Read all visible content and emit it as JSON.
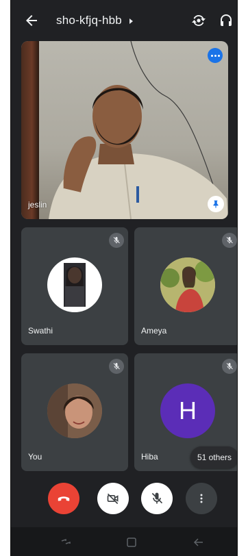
{
  "header": {
    "meeting_code": "sho-kfjq-hbb",
    "back_icon": "arrow-left-icon",
    "switch_camera_icon": "switch-camera-icon",
    "audio_icon": "headphones-icon"
  },
  "main_tile": {
    "name": "jeslin",
    "pinned": true
  },
  "participants": [
    {
      "name": "Swathi",
      "muted": true
    },
    {
      "name": "Ameya",
      "muted": true
    },
    {
      "name": "You",
      "muted": true
    },
    {
      "name": "Hiba",
      "muted": true,
      "initial": "H"
    }
  ],
  "others_chip": "51 others",
  "colors": {
    "background": "#202124",
    "tile": "#3c4043",
    "end_call": "#ea4335",
    "accent": "#1a73e8",
    "letter_avatar": "#5b2db7"
  },
  "controls": {
    "end_call_icon": "phone-hangup-icon",
    "camera_icon": "camera-off-icon",
    "mic_icon": "mic-off-icon",
    "more_icon": "more-vertical-icon"
  }
}
